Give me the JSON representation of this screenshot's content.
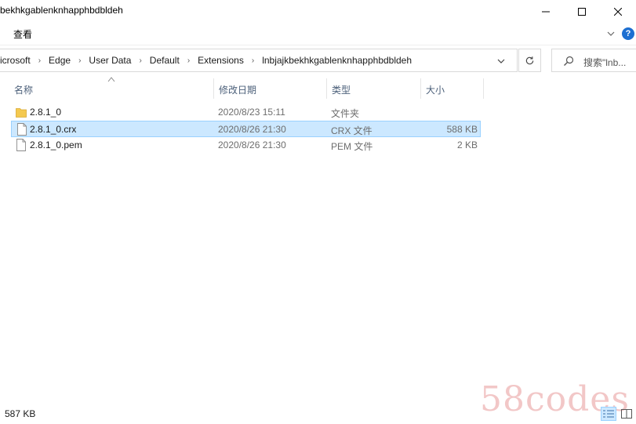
{
  "window": {
    "title": "bekhkgablenknhapphbdbldeh",
    "minimize_icon": "minimize-icon",
    "maximize_icon": "maximize-icon",
    "close_icon": "close-icon"
  },
  "ribbon": {
    "tab_view": "查看",
    "expand_icon": "chevron-down-icon",
    "help_label": "?"
  },
  "address": {
    "crumbs": [
      "icrosoft",
      "Edge",
      "User Data",
      "Default",
      "Extensions",
      "lnbjajkbekhkgablenknhapphbdbldeh"
    ],
    "separator": "›"
  },
  "search": {
    "placeholder": "搜索\"lnb..."
  },
  "columns": {
    "name": "名称",
    "modified": "修改日期",
    "type": "类型",
    "size": "大小"
  },
  "files": [
    {
      "name": "2.8.1_0",
      "modified": "2020/8/23 15:11",
      "type": "文件夹",
      "size": "",
      "icon": "folder-icon",
      "selected": false
    },
    {
      "name": "2.8.1_0.crx",
      "modified": "2020/8/26 21:30",
      "type": "CRX 文件",
      "size": "588 KB",
      "icon": "file-icon",
      "selected": true
    },
    {
      "name": "2.8.1_0.pem",
      "modified": "2020/8/26 21:30",
      "type": "PEM 文件",
      "size": "2 KB",
      "icon": "file-icon",
      "selected": false
    }
  ],
  "status": {
    "text": "587 KB"
  },
  "watermark": "58codes",
  "colors": {
    "selection_bg": "#cce8ff",
    "selection_border": "#99d1ff",
    "folder": "#f4c94f",
    "help": "#1d6fd1"
  }
}
